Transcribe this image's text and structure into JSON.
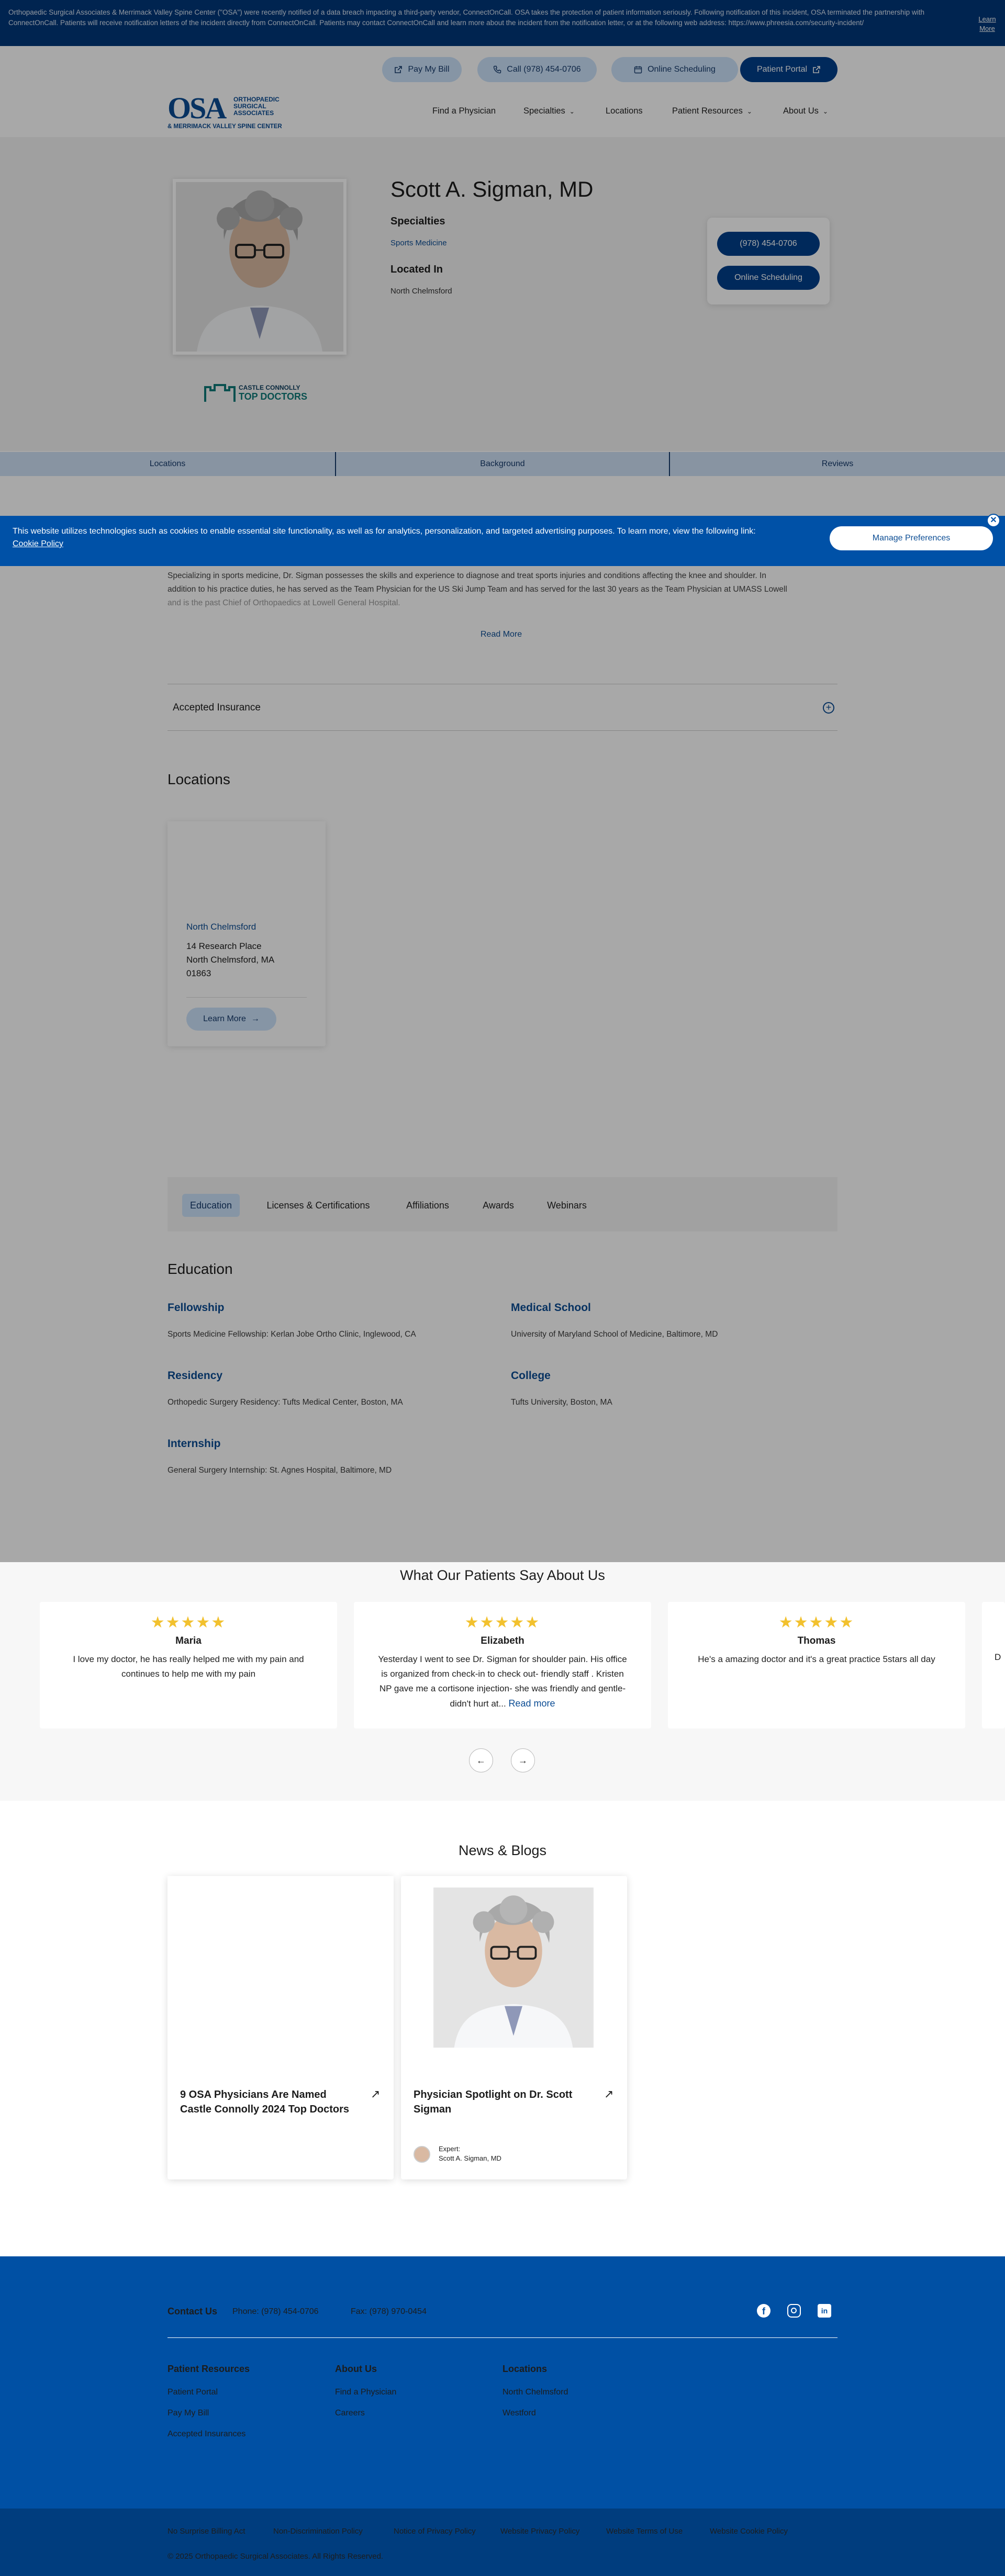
{
  "alert": {
    "text": "Orthopaedic Surgical Associates & Merrimack Valley Spine Center (\"OSA\") were recently notified of a data breach impacting a third-party vendor, ConnectOnCall. OSA takes the protection of patient information seriously. Following notification of this incident, OSA terminated the partnership with ConnectOnCall. Patients will receive notification letters of the incident directly from ConnectOnCall. Patients may contact ConnectOnCall and learn more about the incident from the notification letter, or at the following web address: https://www.phreesia.com/security-incident/",
    "learn_more": "Learn More"
  },
  "topbar": {
    "pay_bill": "Pay My Bill",
    "call": "Call (978) 454-0706",
    "online_scheduling": "Online Scheduling",
    "patient_portal": "Patient Portal"
  },
  "logo": {
    "mark": "OSA",
    "line1": "ORTHOPAEDIC",
    "line2": "SURGICAL",
    "line3": "ASSOCIATES",
    "line4": "& MERRIMACK VALLEY SPINE CENTER"
  },
  "nav": {
    "find_physician": "Find a Physician",
    "specialties": "Specialties",
    "locations": "Locations",
    "patient_resources": "Patient Resources",
    "about_us": "About Us"
  },
  "doctor": {
    "name": "Scott A. Sigman, MD",
    "specialties_label": "Specialties",
    "specialty": "Sports Medicine",
    "located_label": "Located In",
    "location": "North Chelmsford",
    "phone_btn": "(978) 454-0706",
    "schedule_btn": "Online Scheduling",
    "badge_line1": "CASTLE CONNOLLY",
    "badge_line2": "TOP DOCTORS"
  },
  "section_tabs": [
    "Locations",
    "Background",
    "Reviews"
  ],
  "cookie": {
    "text": "This website utilizes technologies such as cookies to enable essential site functionality, as well as for analytics, personalization, and targeted advertising purposes. To learn more, view the following link:",
    "link": "Cookie Policy",
    "manage": "Manage Preferences"
  },
  "bio": {
    "line1": "Specializing in sports medicine, Dr. Sigman possesses the skills and experience to diagnose and treat sports injuries and conditions affecting the knee and shoulder. In",
    "line2": "addition to his practice duties, he has served as the Team Physician for the US Ski Jump Team and has served for the last 30 years as the Team Physician at UMASS Lowell",
    "line3": "and is the past Chief of Orthopaedics at Lowell General Hospital.",
    "read_more": "Read More"
  },
  "insurance": {
    "label": "Accepted Insurance"
  },
  "locations": {
    "heading": "Locations",
    "card": {
      "name": "North Chelmsford",
      "street": "14 Research Place",
      "city": "North Chelmsford, MA",
      "zip": "01863",
      "button": "Learn More"
    }
  },
  "tabs": [
    "Education",
    "Licenses & Certifications",
    "Affiliations",
    "Awards",
    "Webinars"
  ],
  "education": {
    "heading": "Education",
    "fellowship_label": "Fellowship",
    "fellowship": "Sports Medicine Fellowship: Kerlan Jobe Ortho Clinic, Inglewood, CA",
    "med_school_label": "Medical School",
    "med_school": "University of Maryland School of Medicine, Baltimore, MD",
    "residency_label": "Residency",
    "residency": "Orthopedic Surgery Residency: Tufts Medical Center, Boston, MA",
    "college_label": "College",
    "college": "Tufts University, Boston, MA",
    "internship_label": "Internship",
    "internship": "General Surgery Internship: St. Agnes Hospital, Baltimore, MD"
  },
  "reviews": {
    "heading": "What Our Patients Say About Us",
    "stars": "★★★★★",
    "items": [
      {
        "name": "Maria",
        "text": "I love my doctor, he has really helped me with my pain and continues to help me with my pain"
      },
      {
        "name": "Elizabeth",
        "text": "Yesterday I went to see Dr. Sigman for shoulder pain. His office is organized from check-in to check out- friendly staff . Kristen NP gave me a cortisone injection- she was friendly and gentle- didn't hurt at...",
        "read_more": "Read more"
      },
      {
        "name": "Thomas",
        "text": "He's a amazing doctor and it's a great practice 5stars all day"
      }
    ],
    "partial_text": "D",
    "rating": 5
  },
  "news": {
    "heading": "News & Blogs",
    "items": [
      {
        "title": "9 OSA Physicians Are Named Castle Connolly 2024 Top Doctors"
      },
      {
        "title": "Physician Spotlight on Dr. Scott Sigman",
        "expert_label": "Expert:",
        "expert_name": "Scott A. Sigman, MD"
      }
    ]
  },
  "footer": {
    "contact": "Contact Us",
    "phone": "Phone: (978) 454-0706",
    "fax": "Fax: (978) 970-0454",
    "col1_heading": "Patient Resources",
    "col1": [
      "Patient Portal",
      "Pay My Bill",
      "Accepted Insurances"
    ],
    "col2_heading": "About Us",
    "col2": [
      "Find a Physician",
      "Careers"
    ],
    "col3_heading": "Locations",
    "col3": [
      "North Chelmsford",
      "Westford"
    ],
    "legal": [
      "No Surprise Billing Act",
      "Non-Discrimination Policy",
      "Notice of Privacy Policy",
      "Website Privacy Policy",
      "Website Terms of Use",
      "Website Cookie Policy"
    ],
    "copyright": "© 2025 Orthopaedic Surgical Associates. All Rights Reserved."
  },
  "colors": {
    "brand": "#003f8a",
    "light_blue": "#cbe2fb",
    "footer": "#0050a4",
    "star": "#f2c12e"
  }
}
